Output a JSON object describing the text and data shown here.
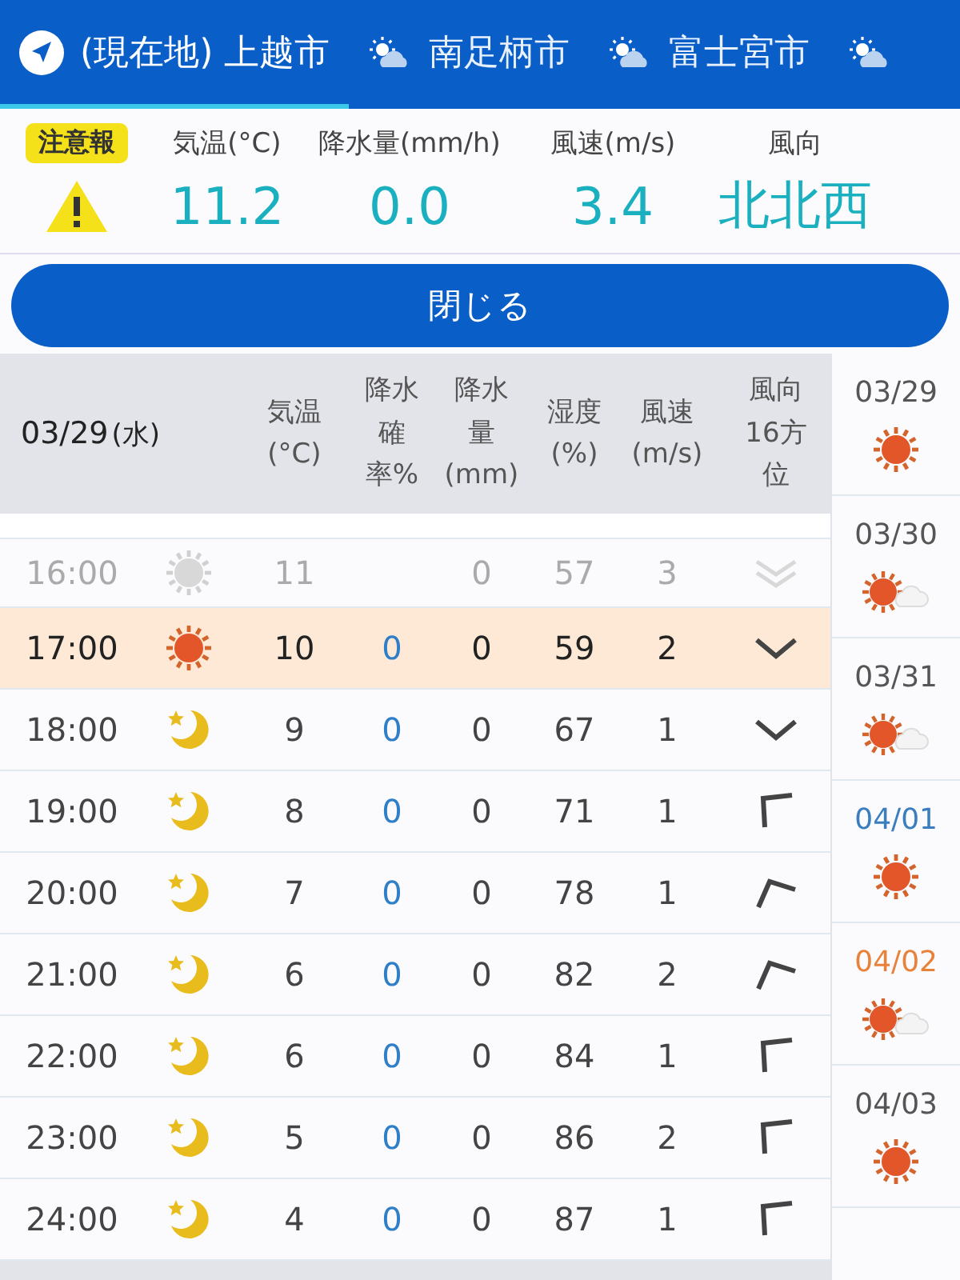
{
  "tabs": [
    {
      "kind": "location",
      "label": "(現在地) 上越市",
      "selected": true
    },
    {
      "kind": "weather",
      "label": "南足柄市",
      "selected": false
    },
    {
      "kind": "weather",
      "label": "富士宮市",
      "selected": false
    },
    {
      "kind": "weather",
      "selected": false
    }
  ],
  "summary": {
    "badge": "注意報",
    "warning": true,
    "headers": [
      "気温(°C)",
      "降水量(mm/h)",
      "風速(m/s)",
      "風向"
    ],
    "values": [
      "11.2",
      "0.0",
      "3.4",
      "北北西"
    ]
  },
  "close_button": "閉じる",
  "table": {
    "date": "03/29",
    "weekday": "(水)",
    "columns": [
      [
        "気温",
        "(°C)"
      ],
      [
        "降水",
        "確率%"
      ],
      [
        "降水",
        "量",
        "(mm)"
      ],
      [
        "湿度",
        "(%)"
      ],
      [
        "風速",
        "(m/s)"
      ],
      [
        "風向",
        "16方",
        "位"
      ]
    ],
    "rows": [
      {
        "time": "16:00",
        "icon": {
          "kind": "sunny"
        },
        "temp": "11",
        "amount": "0",
        "humidity": "57",
        "wind": "3",
        "wind_arrow": {
          "kind": "double"
        },
        "past": true,
        "current": false
      },
      {
        "time": "17:00",
        "icon": {
          "kind": "sunny"
        },
        "temp": "10",
        "prob": "0",
        "amount": "0",
        "humidity": "59",
        "wind": "2",
        "wind_arrow": {
          "kind": "chevron"
        },
        "past": false,
        "current": true
      },
      {
        "time": "18:00",
        "icon": {
          "kind": "night"
        },
        "temp": "9",
        "prob": "0",
        "amount": "0",
        "humidity": "67",
        "wind": "1",
        "wind_arrow": {
          "kind": "chevron"
        },
        "past": false,
        "current": false
      },
      {
        "time": "19:00",
        "icon": {
          "kind": "night"
        },
        "temp": "8",
        "prob": "0",
        "amount": "0",
        "humidity": "71",
        "wind": "1",
        "wind_arrow": {
          "kind": "corner"
        },
        "past": false,
        "current": false
      },
      {
        "time": "20:00",
        "icon": {
          "kind": "night"
        },
        "temp": "7",
        "prob": "0",
        "amount": "0",
        "humidity": "78",
        "wind": "1",
        "wind_arrow": {
          "kind": "peak"
        },
        "past": false,
        "current": false
      },
      {
        "time": "21:00",
        "icon": {
          "kind": "night"
        },
        "temp": "6",
        "prob": "0",
        "amount": "0",
        "humidity": "82",
        "wind": "2",
        "wind_arrow": {
          "kind": "peak"
        },
        "past": false,
        "current": false
      },
      {
        "time": "22:00",
        "icon": {
          "kind": "night"
        },
        "temp": "6",
        "prob": "0",
        "amount": "0",
        "humidity": "84",
        "wind": "1",
        "wind_arrow": {
          "kind": "corner"
        },
        "past": false,
        "current": false
      },
      {
        "time": "23:00",
        "icon": {
          "kind": "night"
        },
        "temp": "5",
        "prob": "0",
        "amount": "0",
        "humidity": "86",
        "wind": "2",
        "wind_arrow": {
          "kind": "corner"
        },
        "past": false,
        "current": false
      },
      {
        "time": "24:00",
        "icon": {
          "kind": "night"
        },
        "temp": "4",
        "prob": "0",
        "amount": "0",
        "humidity": "87",
        "wind": "1",
        "wind_arrow": {
          "kind": "corner"
        },
        "past": false,
        "current": false
      }
    ]
  },
  "days": [
    {
      "date": "03/29",
      "icon": {
        "kind": "sunny"
      },
      "color": "#555555"
    },
    {
      "date": "03/30",
      "icon": {
        "kind": "partly"
      },
      "color": "#555555"
    },
    {
      "date": "03/31",
      "icon": {
        "kind": "partly"
      },
      "color": "#555555"
    },
    {
      "date": "04/01",
      "icon": {
        "kind": "sunny"
      },
      "color": "#3a7ec0"
    },
    {
      "date": "04/02",
      "icon": {
        "kind": "partly"
      },
      "color": "#e8823a"
    },
    {
      "date": "04/03",
      "icon": {
        "kind": "sunny"
      },
      "color": "#555555"
    }
  ]
}
